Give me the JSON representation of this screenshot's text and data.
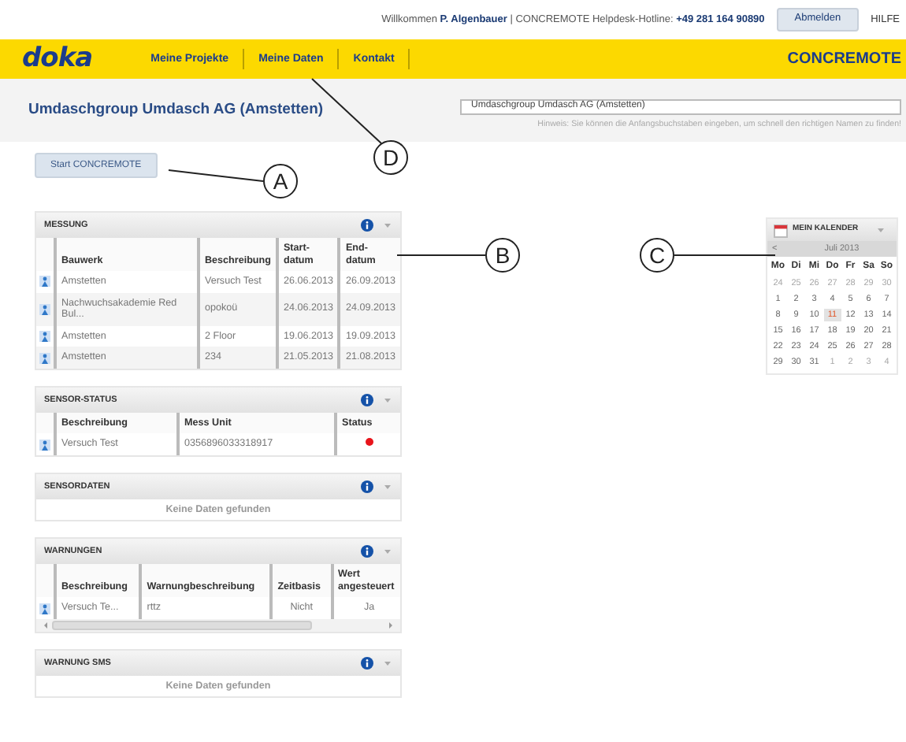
{
  "top_bar": {
    "welcome": "Willkommen **P. Algenbauer** | CONCREMOTE Helpdesk-Hotline: **+49 281 164 90890**",
    "logout_button": "Abmelden",
    "help_link": "HILFE"
  },
  "navbar": {
    "logo": "doka",
    "items": [
      {
        "label": "Meine Projekte",
        "selected": false
      },
      {
        "label": "Meine Daten",
        "selected": false
      },
      {
        "label": "Kontakt",
        "selected": false
      }
    ],
    "brand": "CONCREMOTE"
  },
  "page_title": "Umdaschgroup Umdasch AG (Amstetten)",
  "customer_select": {
    "value": "Umdaschgroup Umdasch AG (Amstetten)",
    "hint": "Hinweis: Sie können die Anfangsbuchstaben eingeben, um schnell den richtigen Namen zu finden!"
  },
  "start_button": "Start CONCREMOTE",
  "widgets": [
    {
      "title": "MESSUNG",
      "kind": "table",
      "columns": [
        "Bauwerk",
        "Beschreibung",
        "Start-\ndatum",
        "End-\ndatum"
      ],
      "rows": [
        {
          "cells": [
            "Amstetten",
            "Versuch Test",
            "26.06.2013",
            "26.09.2013"
          ]
        },
        {
          "cells": [
            "Nachwuchsakademie Red Bul...",
            "opokoü",
            "24.06.2013",
            "24.09.2013"
          ]
        },
        {
          "cells": [
            "Amstetten",
            "2 Floor",
            "19.06.2013",
            "19.09.2013"
          ]
        },
        {
          "cells": [
            "Amstetten",
            "234",
            "21.05.2013",
            "21.08.2013"
          ]
        }
      ]
    },
    {
      "title": "SENSOR-STATUS",
      "kind": "table",
      "columns": [
        "Beschreibung",
        "Mess Unit",
        "Status"
      ],
      "rows": [
        {
          "cells": [
            "Versuch Test",
            "0356896033318917"
          ],
          "color": "#e8141b"
        }
      ]
    },
    {
      "title": "SENSORDATEN",
      "kind": "empty",
      "message": "Keine Daten gefunden"
    },
    {
      "title": "WARNUNGEN",
      "kind": "scroll_table",
      "columns": [
        "Beschreibung",
        "Warnungbeschreibung",
        "Zeitbasis",
        "Wert\nangesteuert"
      ],
      "rows": [
        {
          "cells": [
            "Versuch Te...",
            "rttz",
            "Nicht",
            "Ja"
          ]
        }
      ]
    },
    {
      "title": "WARNUNG SMS",
      "kind": "empty",
      "message": "Keine Daten gefunden"
    }
  ],
  "calendar": {
    "title": "MEIN KALENDER",
    "prev": "<",
    "month": "Juli 2013",
    "weekdays": [
      "Mo",
      "Di",
      "Mi",
      "Do",
      "Fr",
      "Sa",
      "So"
    ],
    "weeks": [
      [
        {
          "day": "24",
          "muted": true,
          "selected": false
        },
        {
          "day": "25",
          "muted": true,
          "selected": false
        },
        {
          "day": "26",
          "muted": true,
          "selected": false
        },
        {
          "day": "27",
          "muted": true,
          "selected": false
        },
        {
          "day": "28",
          "muted": true,
          "selected": false
        },
        {
          "day": "29",
          "muted": true,
          "selected": false
        },
        {
          "day": "30",
          "muted": true,
          "selected": false
        }
      ],
      [
        {
          "day": "1",
          "muted": false,
          "selected": false
        },
        {
          "day": "2",
          "muted": false,
          "selected": false
        },
        {
          "day": "3",
          "muted": false,
          "selected": false
        },
        {
          "day": "4",
          "muted": false,
          "selected": false
        },
        {
          "day": "5",
          "muted": false,
          "selected": false
        },
        {
          "day": "6",
          "muted": false,
          "selected": false
        },
        {
          "day": "7",
          "muted": false,
          "selected": false
        }
      ],
      [
        {
          "day": "8",
          "muted": false,
          "selected": false
        },
        {
          "day": "9",
          "muted": false,
          "selected": false
        },
        {
          "day": "10",
          "muted": false,
          "selected": false
        },
        {
          "day": "11",
          "muted": false,
          "selected": true
        },
        {
          "day": "12",
          "muted": false,
          "selected": false
        },
        {
          "day": "13",
          "muted": false,
          "selected": false
        },
        {
          "day": "14",
          "muted": false,
          "selected": false
        }
      ],
      [
        {
          "day": "15",
          "muted": false,
          "selected": false
        },
        {
          "day": "16",
          "muted": false,
          "selected": false
        },
        {
          "day": "17",
          "muted": false,
          "selected": false
        },
        {
          "day": "18",
          "muted": false,
          "selected": false
        },
        {
          "day": "19",
          "muted": false,
          "selected": false
        },
        {
          "day": "20",
          "muted": false,
          "selected": false
        },
        {
          "day": "21",
          "muted": false,
          "selected": false
        }
      ],
      [
        {
          "day": "22",
          "muted": false,
          "selected": false
        },
        {
          "day": "23",
          "muted": false,
          "selected": false
        },
        {
          "day": "24",
          "muted": false,
          "selected": false
        },
        {
          "day": "25",
          "muted": false,
          "selected": false
        },
        {
          "day": "26",
          "muted": false,
          "selected": false
        },
        {
          "day": "27",
          "muted": false,
          "selected": false
        },
        {
          "day": "28",
          "muted": false,
          "selected": false
        }
      ],
      [
        {
          "day": "29",
          "muted": false,
          "selected": false
        },
        {
          "day": "30",
          "muted": false,
          "selected": false
        },
        {
          "day": "31",
          "muted": false,
          "selected": false
        },
        {
          "day": "1",
          "muted": true,
          "selected": false
        },
        {
          "day": "2",
          "muted": true,
          "selected": false
        },
        {
          "day": "3",
          "muted": true,
          "selected": false
        },
        {
          "day": "4",
          "muted": true,
          "selected": false
        }
      ]
    ]
  },
  "callouts": [
    {
      "label": "A"
    },
    {
      "label": "B"
    },
    {
      "label": "C"
    },
    {
      "label": "D"
    }
  ]
}
